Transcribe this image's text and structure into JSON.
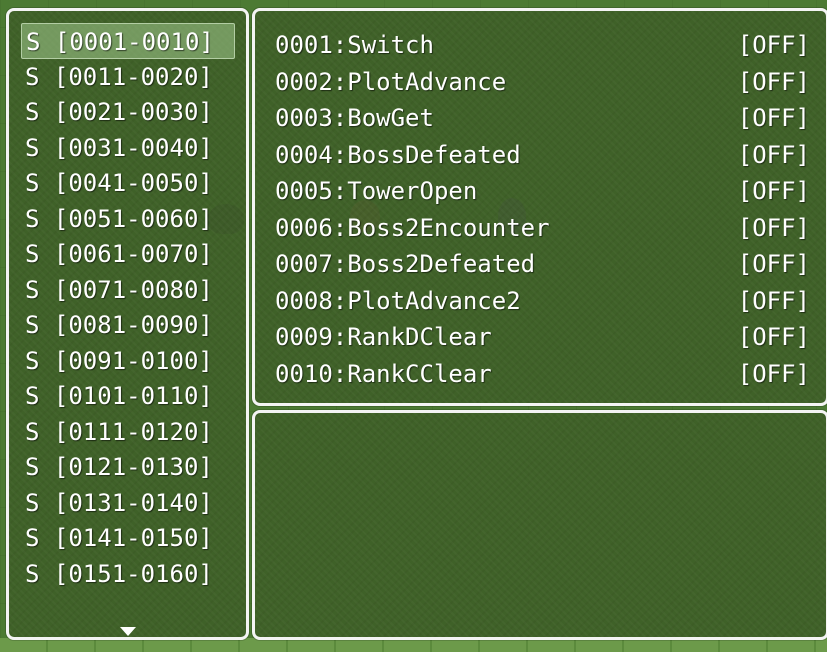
{
  "categories": {
    "selected_index": 0,
    "items": [
      {
        "label": "S [0001-0010]"
      },
      {
        "label": "S [0011-0020]"
      },
      {
        "label": "S [0021-0030]"
      },
      {
        "label": "S [0031-0040]"
      },
      {
        "label": "S [0041-0050]"
      },
      {
        "label": "S [0051-0060]"
      },
      {
        "label": "S [0061-0070]"
      },
      {
        "label": "S [0071-0080]"
      },
      {
        "label": "S [0081-0090]"
      },
      {
        "label": "S [0091-0100]"
      },
      {
        "label": "S [0101-0110]"
      },
      {
        "label": "S [0111-0120]"
      },
      {
        "label": "S [0121-0130]"
      },
      {
        "label": "S [0131-0140]"
      },
      {
        "label": "S [0141-0150]"
      },
      {
        "label": "S [0151-0160]"
      }
    ],
    "more_indicator_icon": "down-triangle-icon"
  },
  "switches": {
    "items": [
      {
        "name": "0001:Switch",
        "state": "[OFF]"
      },
      {
        "name": "0002:PlotAdvance",
        "state": "[OFF]"
      },
      {
        "name": "0003:BowGet",
        "state": "[OFF]"
      },
      {
        "name": "0004:BossDefeated",
        "state": "[OFF]"
      },
      {
        "name": "0005:TowerOpen",
        "state": "[OFF]"
      },
      {
        "name": "0006:Boss2Encounter",
        "state": "[OFF]"
      },
      {
        "name": "0007:Boss2Defeated",
        "state": "[OFF]"
      },
      {
        "name": "0008:PlotAdvance2",
        "state": "[OFF]"
      },
      {
        "name": "0009:RankDClear",
        "state": "[OFF]"
      },
      {
        "name": "0010:RankCClear",
        "state": "[OFF]"
      }
    ]
  },
  "help": {
    "text": ""
  },
  "colors": {
    "window_border": "#f4f4f4",
    "window_fill": "#3e5f28",
    "text": "#ffffff",
    "grass": "#4c7a33"
  }
}
